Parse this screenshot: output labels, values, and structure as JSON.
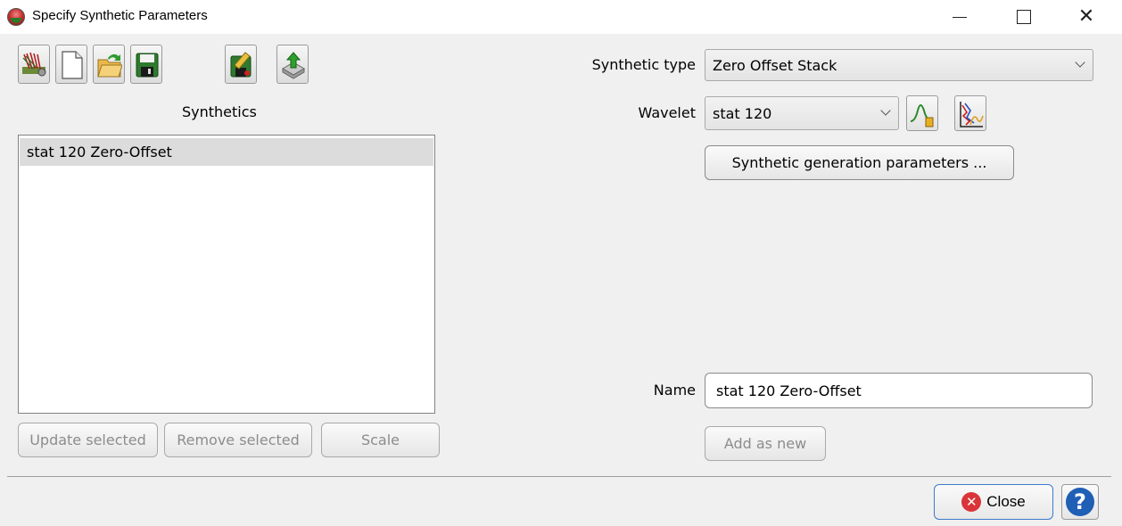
{
  "window": {
    "title": "Specify Synthetic Parameters",
    "controls": {
      "minimize": "minimize",
      "maximize": "maximize",
      "close": "close"
    }
  },
  "toolbar": {
    "icons": [
      "synthetic-generate-icon",
      "new-document-icon",
      "open-folder-icon",
      "save-icon",
      "save-as-icon",
      "export-icon"
    ]
  },
  "left": {
    "list_title": "Synthetics",
    "items": [
      "stat 120 Zero-Offset"
    ],
    "buttons": {
      "update": "Update selected",
      "remove": "Remove selected",
      "scale": "Scale"
    }
  },
  "right": {
    "synthetic_type_label": "Synthetic type",
    "synthetic_type_value": "Zero Offset Stack",
    "wavelet_label": "Wavelet",
    "wavelet_value": "stat 120",
    "gen_params_label": "Synthetic generation parameters ...",
    "name_label": "Name",
    "name_value": "stat 120 Zero-Offset",
    "add_as_new_label": "Add as new"
  },
  "footer": {
    "close_label": "Close",
    "help_symbol": "?"
  },
  "colors": {
    "close_border": "#3d7acb",
    "close_icon": "#d9343a",
    "help_icon": "#1f5fb5",
    "disabled_text": "#8c8c8c"
  }
}
